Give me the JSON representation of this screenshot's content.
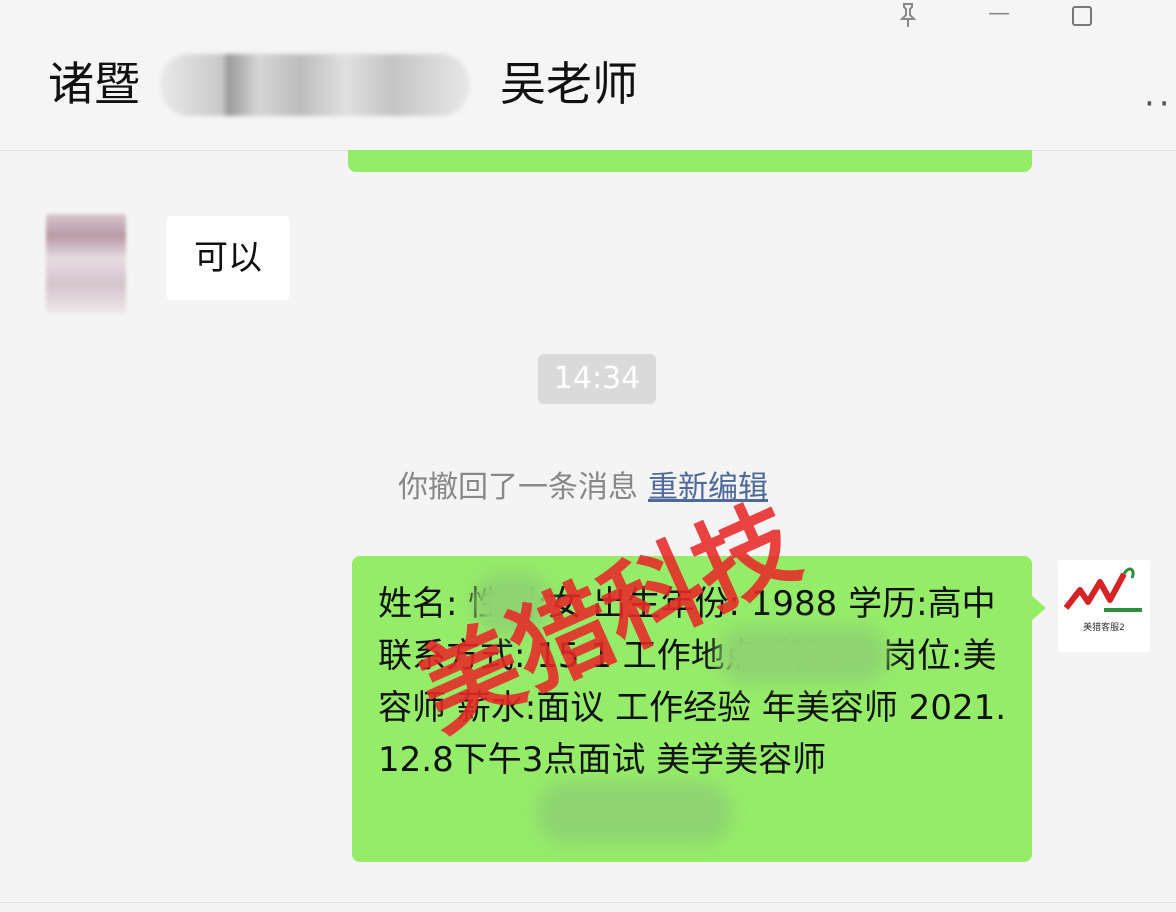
{
  "window": {
    "pin_icon": "pin-icon",
    "minimize_icon": "minimize-icon",
    "maximize_icon": "maximize-icon"
  },
  "header": {
    "title_prefix": "诸暨",
    "title_suffix": "吴老师",
    "more_icon": "more-icon"
  },
  "messages": {
    "incoming_text": "可以",
    "timestamp": "14:34",
    "recall_notice": "你撤回了一条消息",
    "recall_link": "重新编辑",
    "outgoing_text": "姓名:  性别:女 出生年份: 1988 学历:高中 联系方式: 15 1 工作地点:浙江一 岗位:美容师 薪水:面议 工作经验 年美容师 2021.12.8下午3点面试 美学美容师"
  },
  "watermark": {
    "text": "美猎科技"
  },
  "avatar_right": {
    "caption": "美猎客服2"
  },
  "colors": {
    "bubble_self": "#95ec69",
    "watermark": "#e82828",
    "link": "#4f6a9a"
  }
}
